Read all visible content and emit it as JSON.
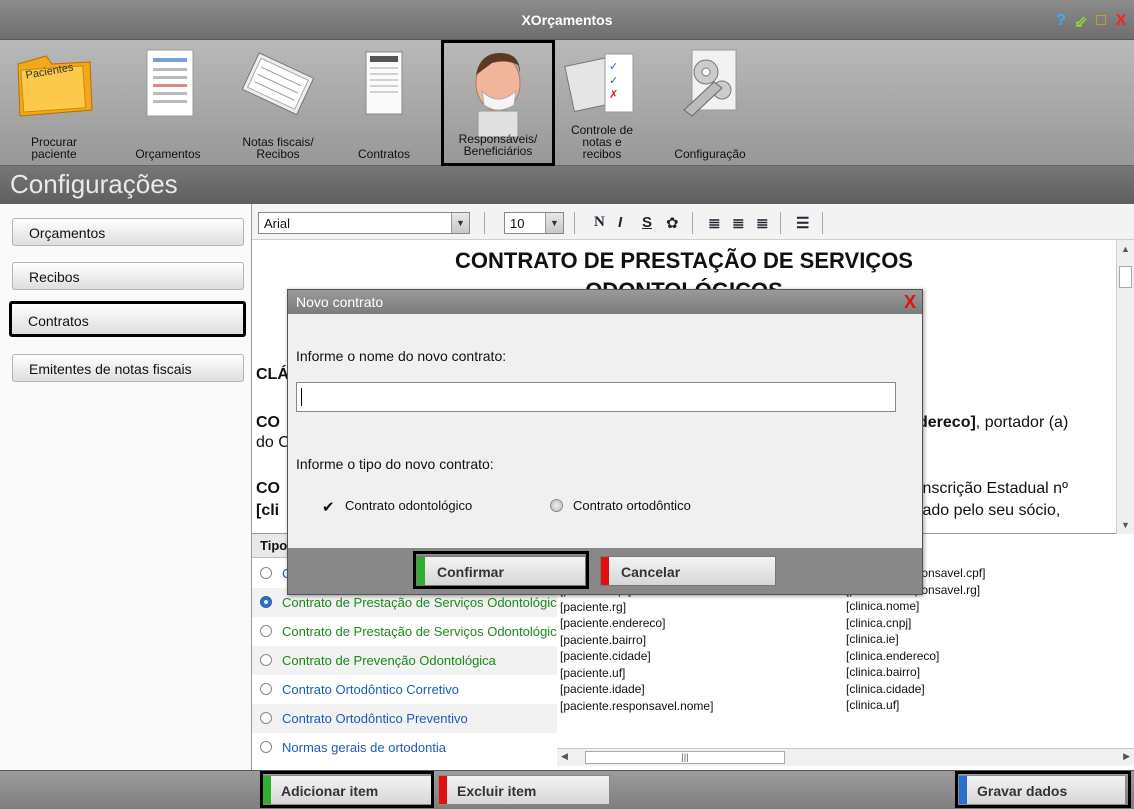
{
  "window": {
    "title": "XOrçamentos",
    "controls": [
      "?",
      "⇙",
      "□",
      "X"
    ]
  },
  "toolbar": {
    "items": [
      {
        "label": "Procurar\npaciente",
        "icon": "patient-folder-icon",
        "folder_text": "Pacientes"
      },
      {
        "label": "Orçamentos",
        "icon": "budget-document-icon"
      },
      {
        "label": "Notas fiscais/\nRecibos",
        "icon": "invoice-stack-icon"
      },
      {
        "label": "Contratos",
        "icon": "contract-scroll-icon"
      },
      {
        "label": "Responsáveis/\nBeneficiários",
        "icon": "masked-person-icon"
      },
      {
        "label": "Controle de\nnotas e\nrecibos",
        "icon": "checklist-icon"
      },
      {
        "label": "Configuração",
        "icon": "wrench-gears-icon"
      }
    ]
  },
  "section": {
    "title": "Configurações"
  },
  "nav": {
    "items": [
      "Orçamentos",
      "Recibos",
      "Contratos",
      "Emitentes de notas fiscais"
    ]
  },
  "editor": {
    "font_name": "Arial",
    "font_size": "10",
    "format_buttons": [
      "N",
      "I",
      "S"
    ],
    "heading": "CONTRATO DE PRESTAÇÃO DE SERVIÇOS",
    "heading2": "ODONTOLÓGICOS",
    "frag_clausula": "CLÁ",
    "frag_co1": "CO",
    "frag_do": "do C",
    "frag_endereco_bold": "dereco]",
    "frag_endereco_rest": ", portador (a)",
    "frag_co2": "CO",
    "frag_cli": "[cli",
    "frag_inscricao": "Inscrição Estadual nº",
    "frag_socio": "tado pelo seu sócio,"
  },
  "list": {
    "header": "Tipo",
    "rows": [
      {
        "label": "C",
        "color": "blue",
        "selected": false
      },
      {
        "label": "Contrato de Prestação de Serviços Odontológicos",
        "color": "green",
        "selected": true
      },
      {
        "label": "Contrato de Prestação de Serviços Odontológicos",
        "color": "green",
        "selected": false
      },
      {
        "label": "Contrato de Prevenção Odontológica",
        "color": "green",
        "selected": false
      },
      {
        "label": "Contrato Ortodôntico Corretivo",
        "color": "blue",
        "selected": false
      },
      {
        "label": "Contrato Ortodôntico Preventivo",
        "color": "blue",
        "selected": false
      },
      {
        "label": "Normas gerais de ortodontia",
        "color": "blue",
        "selected": false
      }
    ]
  },
  "variables": {
    "col1": [
      "[paciente.cpf]",
      "[paciente.rg]",
      "[paciente.endereco]",
      "[paciente.bairro]",
      "[paciente.cidade]",
      "[paciente.uf]",
      "[paciente.idade]",
      "[paciente.responsavel.nome]"
    ],
    "col2": [
      "[paciente.responsavel.cpf]",
      "[paciente.responsavel.rg]",
      "[clinica.nome]",
      "[clinica.cnpj]",
      "[clinica.ie]",
      "[clinica.endereco]",
      "[clinica.bairro]",
      "[clinica.cidade]",
      "[clinica.uf]"
    ],
    "col2_first_visible": "esponsavel.cpf]"
  },
  "bottom": {
    "add_label": "Adicionar item",
    "delete_label": "Excluir item",
    "save_label": "Gravar dados"
  },
  "modal": {
    "title": "Novo contrato",
    "name_prompt": "Informe o nome do novo contrato:",
    "name_value": "",
    "type_prompt": "Informe o tipo do novo contrato:",
    "option_odonto": "Contrato odontológico",
    "option_orto": "Contrato ortodôntico",
    "selected_type": "Contrato odontológico",
    "confirm_label": "Confirmar",
    "cancel_label": "Cancelar"
  },
  "colors": {
    "accent_red": "#e01010",
    "accent_green": "#2fae2f",
    "accent_blue": "#2a6fcf"
  }
}
